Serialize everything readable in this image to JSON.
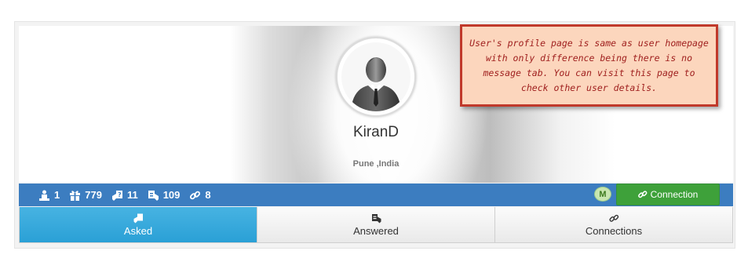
{
  "profile": {
    "username": "KiranD",
    "location": "Pune ,India",
    "avatar_icon": "user-avatar-icon"
  },
  "note": {
    "text": "User's profile page is same as user homepage with only difference being there is no message tab. You can visit this page to check other user details."
  },
  "stats": [
    {
      "icon": "rank-icon",
      "value": "1"
    },
    {
      "icon": "gift-icon",
      "value": "779"
    },
    {
      "icon": "asked-icon",
      "value": "11"
    },
    {
      "icon": "answered-icon",
      "value": "109"
    },
    {
      "icon": "link-icon",
      "value": "8"
    }
  ],
  "actions": {
    "badge": "M",
    "connection_label": "Connection"
  },
  "tabs": [
    {
      "label": "Asked",
      "icon": "asked-icon",
      "active": true
    },
    {
      "label": "Answered",
      "icon": "answered-icon",
      "active": false
    },
    {
      "label": "Connections",
      "icon": "link-icon",
      "active": false
    }
  ],
  "colors": {
    "stats_bar": "#3c7dc0",
    "connection_button": "#3ea13a",
    "active_tab": "#2aa0d6",
    "note_background": "#fcd6bd",
    "note_border": "#c0392b",
    "note_text": "#a0201f"
  }
}
